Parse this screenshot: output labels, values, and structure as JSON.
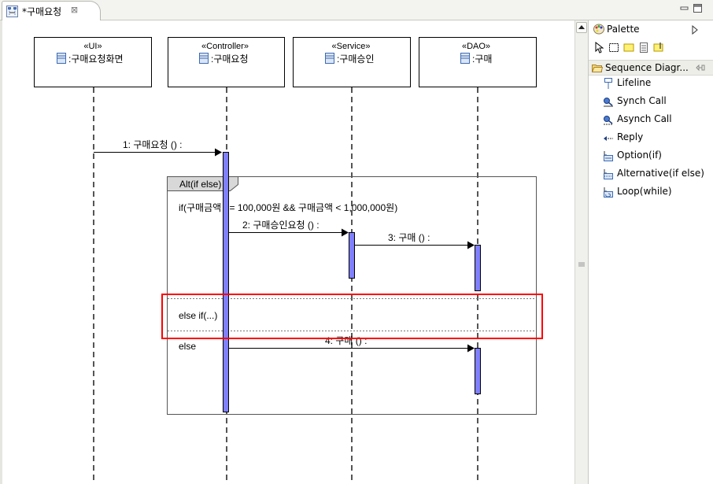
{
  "editor": {
    "tab_title": "*구매요청",
    "tab_close": "⊠"
  },
  "lifelines": [
    {
      "stereotype": "«UI»",
      "name": ":구매요청화면"
    },
    {
      "stereotype": "«Controller»",
      "name": ":구매요청"
    },
    {
      "stereotype": "«Service»",
      "name": ":구매승인"
    },
    {
      "stereotype": "«DAO»",
      "name": ":구매"
    }
  ],
  "messages": [
    {
      "label": "1:  구매요청 () :"
    },
    {
      "label": "2:  구매승인요청 () :"
    },
    {
      "label": "3:  구매 () :"
    },
    {
      "label": "4:  구매 () :"
    }
  ],
  "fragment": {
    "title": "Alt(if else)",
    "guards": [
      "if(구매금액 >= 100,000원 && 구매금액 < 1,000,000원)",
      "else if(...)",
      "else"
    ]
  },
  "palette": {
    "title": "Palette",
    "drawer": "Sequence Diagr...",
    "items": [
      {
        "label": "Lifeline",
        "icon": "lifeline-icon"
      },
      {
        "label": "Synch Call",
        "icon": "synch-call-icon"
      },
      {
        "label": "Asynch Call",
        "icon": "asynch-call-icon"
      },
      {
        "label": "Reply",
        "icon": "reply-icon"
      },
      {
        "label": "Option(if)",
        "icon": "option-icon"
      },
      {
        "label": "Alternative(if else)",
        "icon": "alternative-icon"
      },
      {
        "label": "Loop(while)",
        "icon": "loop-icon"
      }
    ]
  },
  "colors": {
    "activation": "#8080ff",
    "highlight": "#ff0000",
    "fragment_header": "#d8d8d8"
  }
}
